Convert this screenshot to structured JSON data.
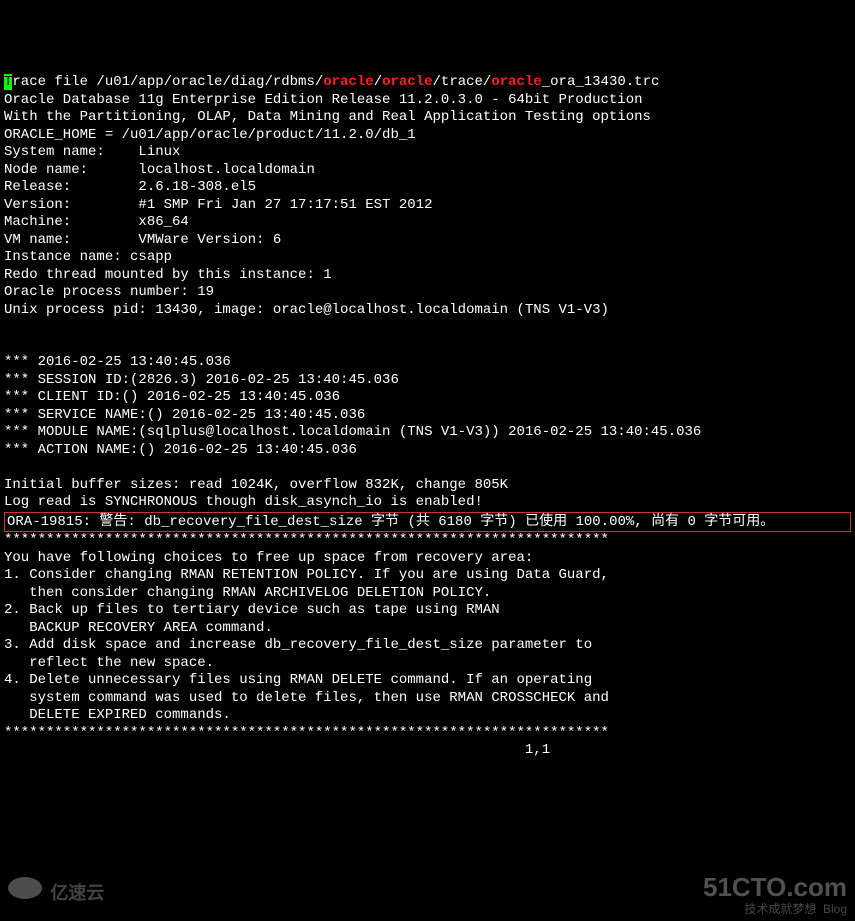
{
  "term": {
    "cursor": "T",
    "line1_a": "race file /u01/app/oracle/diag/rdbms/",
    "line1_r1": "oracle",
    "line1_b": "/",
    "line1_r2": "oracle",
    "line1_c": "/trace/",
    "line1_r3": "oracle",
    "line1_d": "_ora_13430.trc",
    "l2": "Oracle Database 11g Enterprise Edition Release 11.2.0.3.0 - 64bit Production",
    "l3": "With the Partitioning, OLAP, Data Mining and Real Application Testing options",
    "l4": "ORACLE_HOME = /u01/app/oracle/product/11.2.0/db_1",
    "l5": "System name:    Linux",
    "l6": "Node name:      localhost.localdomain",
    "l7": "Release:        2.6.18-308.el5",
    "l8": "Version:        #1 SMP Fri Jan 27 17:17:51 EST 2012",
    "l9": "Machine:        x86_64",
    "l10": "VM name:        VMWare Version: 6",
    "l11": "Instance name: csapp",
    "l12": "Redo thread mounted by this instance: 1",
    "l13": "Oracle process number: 19",
    "l14": "Unix process pid: 13430, image: oracle@localhost.localdomain (TNS V1-V3)",
    "l15": "",
    "l16": "",
    "l17": "*** 2016-02-25 13:40:45.036",
    "l18": "*** SESSION ID:(2826.3) 2016-02-25 13:40:45.036",
    "l19": "*** CLIENT ID:() 2016-02-25 13:40:45.036",
    "l20": "*** SERVICE NAME:() 2016-02-25 13:40:45.036",
    "l21": "*** MODULE NAME:(sqlplus@localhost.localdomain (TNS V1-V3)) 2016-02-25 13:40:45.036",
    "l22": "*** ACTION NAME:() 2016-02-25 13:40:45.036",
    "l23": "",
    "l24": "Initial buffer sizes: read 1024K, overflow 832K, change 805K",
    "l25": "Log read is SYNCHRONOUS though disk_asynch_io is enabled!",
    "box": "ORA-19815: 警告: db_recovery_file_dest_size 字节 (共 6180 字节) 已使用 100.00%, 尚有 0 字节可用。",
    "l26": "************************************************************************",
    "l27": "You have following choices to free up space from recovery area:",
    "l28": "1. Consider changing RMAN RETENTION POLICY. If you are using Data Guard,",
    "l29": "   then consider changing RMAN ARCHIVELOG DELETION POLICY.",
    "l30": "2. Back up files to tertiary device such as tape using RMAN",
    "l31": "   BACKUP RECOVERY AREA command.",
    "l32": "3. Add disk space and increase db_recovery_file_dest_size parameter to",
    "l33": "   reflect the new space.",
    "l34": "4. Delete unnecessary files using RMAN DELETE command. If an operating",
    "l35": "   system command was used to delete files, then use RMAN CROSSCHECK and",
    "l36": "   DELETE EXPIRED commands.",
    "l37": "************************************************************************",
    "status": "                                                              1,1",
    "wm": "51CTO.com",
    "wm2": "技术成就梦想  Blog",
    "wm3": "亿速云"
  }
}
